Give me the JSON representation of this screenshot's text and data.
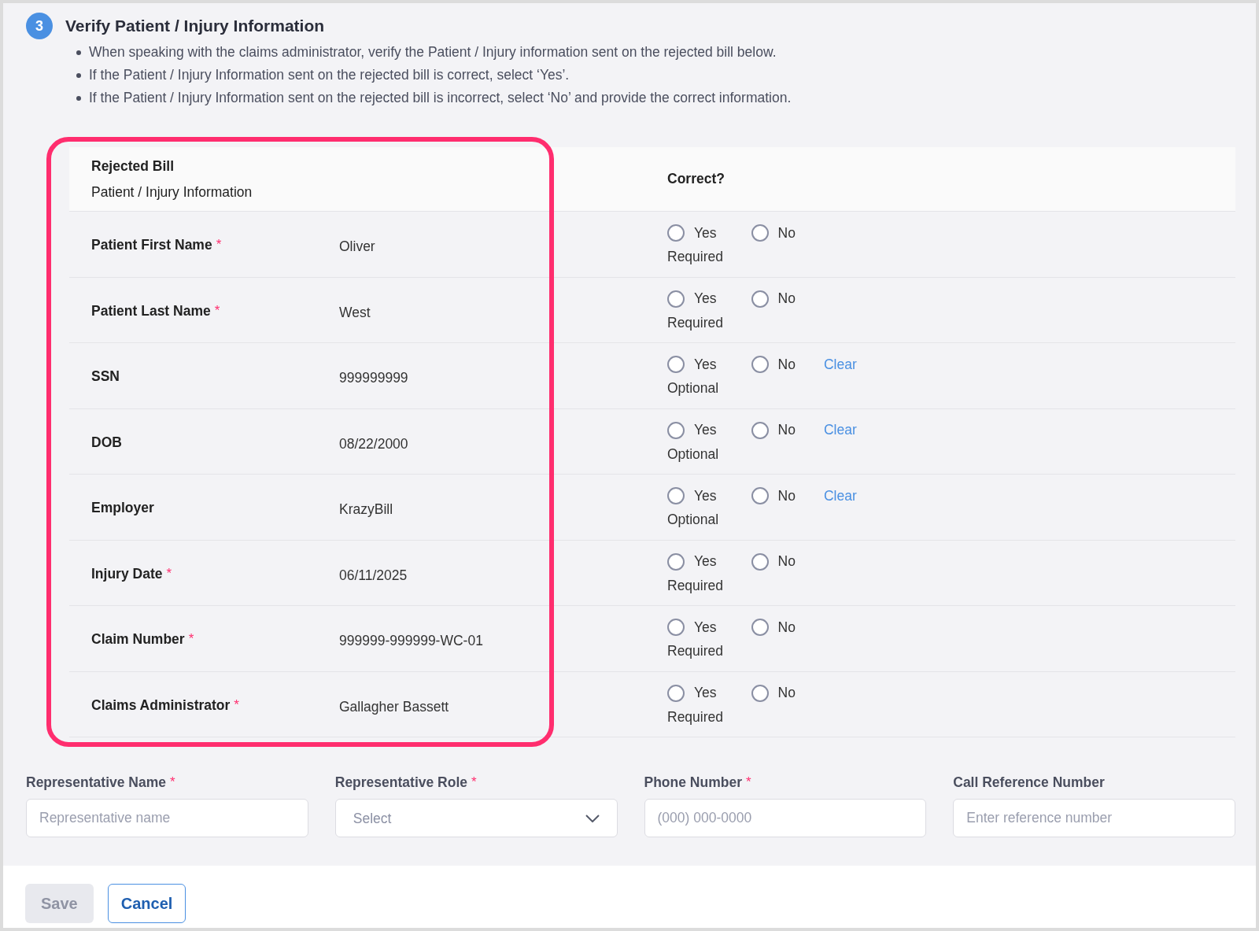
{
  "step": {
    "number": "3",
    "title": "Verify Patient / Injury Information"
  },
  "instructions": [
    "When speaking with the claims administrator, verify the Patient / Injury information sent on the rejected bill below.",
    "If the Patient / Injury Information sent on the rejected bill is correct, select ‘Yes’.",
    "If the Patient / Injury Information sent on the rejected bill is incorrect, select ‘No’ and provide the correct information."
  ],
  "table": {
    "header": {
      "title": "Rejected Bill",
      "subtitle": "Patient / Injury Information",
      "correct": "Correct?"
    },
    "rows": [
      {
        "label": "Patient First Name",
        "required_mark": "*",
        "value": "Oliver",
        "options": [
          {
            "label": "Yes",
            "selected": false
          },
          {
            "label": "No",
            "selected": false
          }
        ],
        "note": "Required"
      },
      {
        "label": "Patient Last Name",
        "required_mark": "*",
        "value": "West",
        "options": [
          {
            "label": "Yes",
            "selected": false
          },
          {
            "label": "No",
            "selected": false
          }
        ],
        "note": "Required"
      },
      {
        "label": "SSN",
        "value": "999999999",
        "options": [
          {
            "label": "Yes",
            "selected": false
          },
          {
            "label": "No",
            "selected": false
          }
        ],
        "note": "Optional",
        "clear": "Clear"
      },
      {
        "label": "DOB",
        "value": "08/22/2000",
        "options": [
          {
            "label": "Yes",
            "selected": false
          },
          {
            "label": "No",
            "selected": false
          }
        ],
        "note": "Optional",
        "clear": "Clear"
      },
      {
        "label": "Employer",
        "value": "KrazyBill",
        "options": [
          {
            "label": "Yes",
            "selected": false
          },
          {
            "label": "No",
            "selected": false
          }
        ],
        "note": "Optional",
        "clear": "Clear"
      },
      {
        "label": "Injury Date",
        "required_mark": "*",
        "value": "06/11/2025",
        "options": [
          {
            "label": "Yes",
            "selected": false
          },
          {
            "label": "No",
            "selected": false
          }
        ],
        "note": "Required"
      },
      {
        "label": "Claim Number",
        "required_mark": "*",
        "value": "999999-999999-WC-01",
        "options": [
          {
            "label": "Yes",
            "selected": false
          },
          {
            "label": "No",
            "selected": false
          }
        ],
        "note": "Required"
      },
      {
        "label": "Claims Administrator",
        "required_mark": "*",
        "value": "Gallagher Bassett",
        "options": [
          {
            "label": "Yes",
            "selected": false
          },
          {
            "label": "No",
            "selected": false
          }
        ],
        "note": "Required"
      }
    ]
  },
  "fields": [
    {
      "kind": "text",
      "label": "Representative Name",
      "required_mark": "*",
      "placeholder": "Representative name"
    },
    {
      "kind": "select",
      "label": "Representative Role",
      "required_mark": "*",
      "placeholder": "Select"
    },
    {
      "kind": "text",
      "label": "Phone Number",
      "required_mark": "*",
      "placeholder": "(000) 000-0000"
    },
    {
      "kind": "text",
      "label": "Call Reference Number",
      "placeholder": "Enter reference number"
    }
  ],
  "buttons": [
    {
      "label": "Save",
      "disabled": true
    },
    {
      "label": "Cancel",
      "disabled": false
    }
  ]
}
